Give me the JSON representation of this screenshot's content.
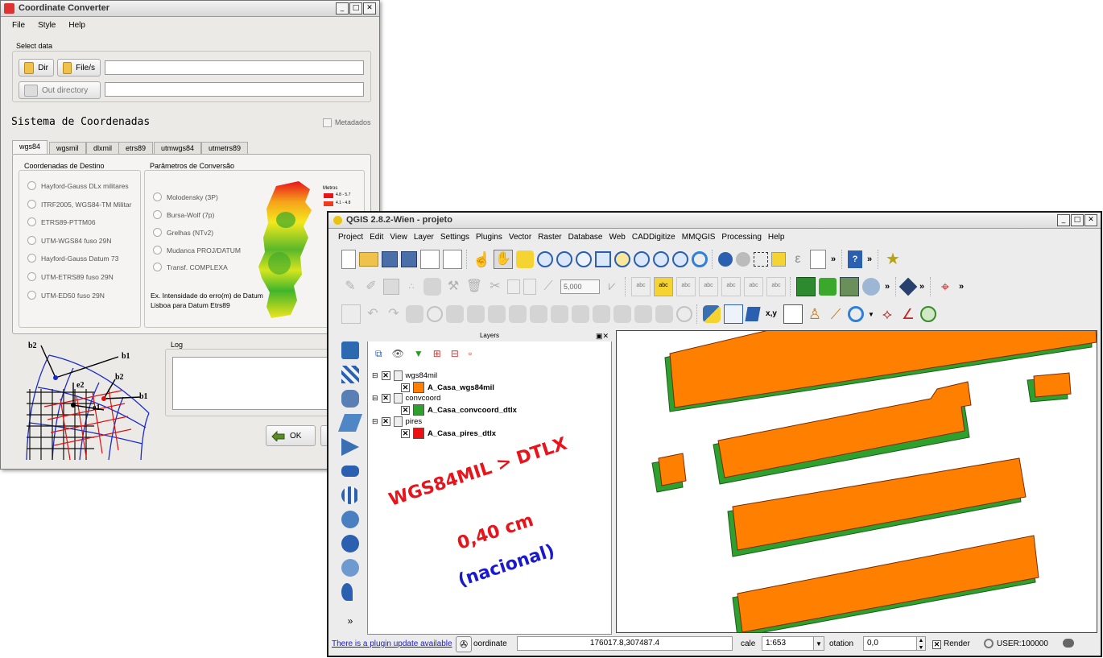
{
  "converter": {
    "title": "Coordinate Converter",
    "menu": [
      "File",
      "Style",
      "Help"
    ],
    "select_data_label": "Select data",
    "dir_button": "Dir",
    "files_button": "File/s",
    "out_dir_button": "Out directory",
    "section_title": "Sistema de Coordenadas",
    "metadados_label": "Metadados",
    "tabs": [
      "wgs84",
      "wgsmil",
      "dlxmil",
      "etrs89",
      "utmwgs84",
      "utmetrs89"
    ],
    "destino_group": "Coordenadas de Destino",
    "destino_options": [
      "Hayford-Gauss DLx militares",
      "ITRF2005, WGS84-TM Militar",
      "ETRS89-PTTM06",
      "UTM-WGS84 fuso 29N",
      "Hayford-Gauss Datum 73",
      "UTM-ETRS89 fuso 29N",
      "UTM-ED50 fuso 29N"
    ],
    "conversao_group": "Parâmetros de Conversão",
    "conversao_options": [
      "Molodensky (3P)",
      "Bursa-Wolf (7p)",
      "Grelhas (NTv2)",
      "Mudanca PROJ/DATUM",
      "Transf. COMPLEXA"
    ],
    "map_note": "Ex. Intensidade do erro(m) de Datum Lisboa para Datum Etrs89",
    "legend_title": "Metros",
    "legend_items": [
      "4.8 - 5.7",
      "4.1 - 4.8"
    ],
    "diagram_labels": [
      "b2",
      "b1",
      "e2",
      "b2",
      "e1",
      "b1"
    ],
    "log_label": "Log",
    "ok_button": "OK"
  },
  "qgis": {
    "title": "QGIS 2.8.2-Wien - projeto",
    "menu": [
      "Project",
      "Edit",
      "View",
      "Layer",
      "Settings",
      "Plugins",
      "Vector",
      "Raster",
      "Database",
      "Web",
      "CADDigitize",
      "MMQGIS",
      "Processing",
      "Help"
    ],
    "snap_value": "5,000",
    "layers_title": "Layers",
    "layer_groups": [
      {
        "name": "wgs84mil",
        "layer": "A_Casa_wgs84mil",
        "color": "#ff8000"
      },
      {
        "name": "convcoord",
        "layer": "A_Casa_convcoord_dtlx",
        "color": "#2ea02e"
      },
      {
        "name": "pires",
        "layer": "A_Casa_pires_dtlx",
        "color": "#ee1111"
      }
    ],
    "overlay": {
      "line1": "WGS84MIL > DTLX",
      "line2": "0,40 cm",
      "line3": "(nacional)"
    },
    "status": {
      "plugin_update": "There is a plugin update available",
      "coordinate_label": "oordinate",
      "coordinate_value": "176017.8,307487.4",
      "scale_label": "cale",
      "scale_value": "1:653",
      "rotation_label": "otation",
      "rotation_value": "0,0",
      "render_label": "Render",
      "crs_label": "USER:100000"
    },
    "colors": {
      "building_fill": "#ff8000",
      "building_shadow": "#2ea02e",
      "building_edge": "#ee1111"
    }
  }
}
